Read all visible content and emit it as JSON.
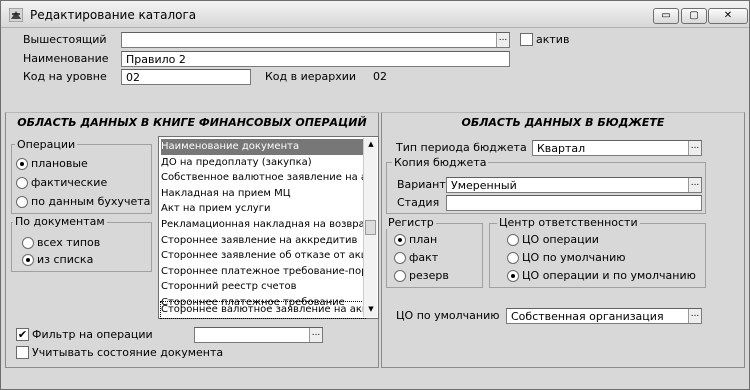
{
  "window": {
    "title": "Редактирование каталога",
    "controls": [
      "▭",
      "▢",
      "✕"
    ]
  },
  "header": {
    "parent_label": "Вышестоящий",
    "parent_value": "",
    "active_label": "актив",
    "active_checked": false,
    "name_label": "Наименование",
    "name_value": "Правило 2",
    "level_code_label": "Код на уровне",
    "level_code_value": "02",
    "hier_code_label": "Код в иерархии",
    "hier_code_value": "02"
  },
  "left_panel": {
    "title": "ОБЛАСТЬ ДАННЫХ В КНИГЕ ФИНАНСОВЫХ ОПЕРАЦИЙ",
    "operations": {
      "title": "Операции",
      "options": [
        "плановые",
        "фактические",
        "по данным бухучета"
      ],
      "selected_index": 0
    },
    "by_docs": {
      "title": "По документам",
      "options": [
        "всех типов",
        "из списка"
      ],
      "selected_index": 1
    },
    "doc_list": [
      "Наименование документа",
      "ДО на предоплату (закупка)",
      "Собственное валютное заявление на акк",
      "Накладная на прием МЦ",
      "Акт на прием услуги",
      "Рекламационная накладная на возврат МI",
      "Стороннее заявление на аккредитив",
      "Стороннее заявление об отказе от акцепт",
      "Стороннее платежное требование-поруче",
      "Сторонний реестр счетов",
      "Стороннее платежное требование",
      "Стороннее валютное заявление на акк"
    ],
    "selected_doc_index": 0,
    "focused_doc_index": 11,
    "filter_label": "Фильтр на операции",
    "filter_checked": true,
    "filter_value": "",
    "state_label": "Учитывать состояние документа",
    "state_checked": false
  },
  "right_panel": {
    "title": "ОБЛАСТЬ ДАННЫХ В БЮДЖЕТЕ",
    "period_label": "Тип периода бюджета",
    "period_value": "Квартал",
    "copy": {
      "title": "Копия бюджета",
      "variant_label": "Вариант",
      "variant_value": "Умеренный",
      "stage_label": "Стадия",
      "stage_value": ""
    },
    "register": {
      "title": "Регистр",
      "options": [
        "план",
        "факт",
        "резерв"
      ],
      "selected_index": 0
    },
    "resp_center": {
      "title": "Центр ответственности",
      "options": [
        "ЦО операции",
        "ЦО по умолчанию",
        "ЦО операции и по умолчанию"
      ],
      "selected_index": 2
    },
    "default_rc_label": "ЦО по умолчанию",
    "default_rc_value": "Собственная организация"
  },
  "icons": {
    "ellipsis": "...",
    "check": "✔",
    "scroll_up": "▲",
    "scroll_down": "▼"
  }
}
